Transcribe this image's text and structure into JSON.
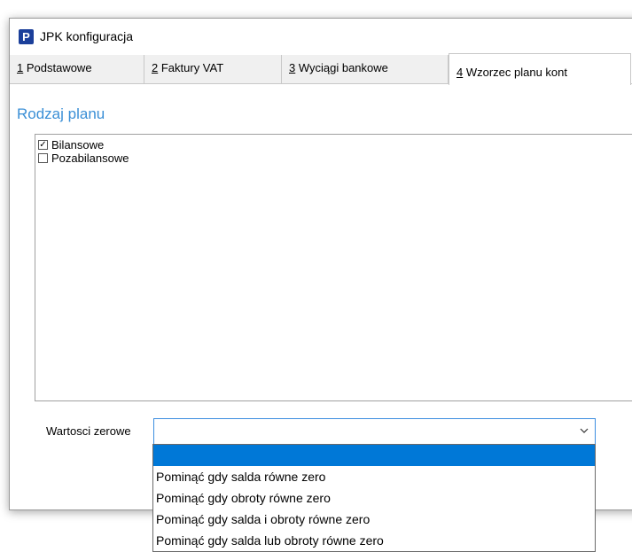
{
  "window": {
    "title": "JPK konfiguracja",
    "icon": "app-p-icon",
    "icon_letter": "P"
  },
  "tabs": [
    {
      "mnemonic": "1",
      "label": " Podstawowe",
      "active": false
    },
    {
      "mnemonic": "2",
      "label": " Faktury VAT",
      "active": false
    },
    {
      "mnemonic": "3",
      "label": " Wyciągi bankowe",
      "active": false
    },
    {
      "mnemonic": "4",
      "label": " Wzorzec planu kont",
      "active": true
    }
  ],
  "section": {
    "title": "Rodzaj planu",
    "title_color": "#3a8fd6"
  },
  "plan_types": [
    {
      "label": "Bilansowe",
      "checked": true
    },
    {
      "label": "Pozabilansowe",
      "checked": false
    }
  ],
  "zero_values": {
    "label": "Wartosci zerowe",
    "selected_value": "",
    "options": [
      "",
      "Pominąć gdy salda równe zero",
      "Pominąć gdy obroty równe zero",
      "Pominąć gdy salda i obroty równe zero",
      "Pominąć gdy salda lub obroty równe zero"
    ],
    "highlighted_index": 0,
    "highlight_color": "#0078d7"
  }
}
